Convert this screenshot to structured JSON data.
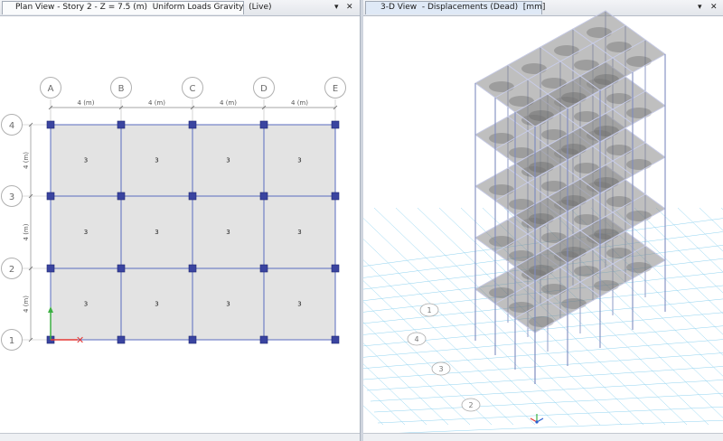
{
  "left_window": {
    "title": "Plan View - Story 2 - Z = 7.5 (m)  Uniform Loads Gravity  (Live)",
    "dropdown_glyph": "▾",
    "close_glyph": "✕",
    "grid": {
      "column_labels": [
        "A",
        "B",
        "C",
        "D",
        "E"
      ],
      "row_labels": [
        "4",
        "3",
        "2",
        "1"
      ],
      "horizontal_spacing_label": "4 (m)",
      "vertical_spacing_label": "4 (m)",
      "area_value": "3"
    },
    "axis_x_color": "#e53935",
    "axis_y_color": "#3cb043"
  },
  "right_window": {
    "title": "3-D View  - Displacements (Dead)  [mm]",
    "dropdown_glyph": "▾",
    "close_glyph": "✕",
    "grid_bubbles": [
      "1",
      "4",
      "3",
      "2"
    ]
  },
  "colors": {
    "column_node": "#3a44a0",
    "grid_line": "#5a6bbf",
    "slab_fill": "#e3e3e3",
    "ground_grid": "#8fd3f0"
  }
}
